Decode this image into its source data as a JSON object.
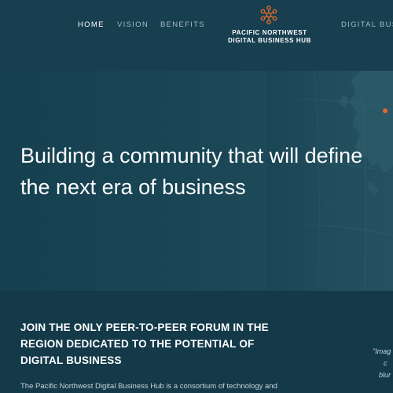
{
  "nav": {
    "links": [
      "HOME",
      "VISION",
      "BENEFITS"
    ],
    "right_link": "DIGITAL BUSI",
    "logo_line1": "PACIFIC NORTHWEST",
    "logo_line2": "DIGITAL BUSINESS HUB",
    "logo_icon": "hub-network-icon",
    "accent": "#e26a2c"
  },
  "hero": {
    "title": "Building a community that will define\nthe next era of business"
  },
  "forum": {
    "heading": "JOIN THE ONLY PEER-TO-PEER FORUM IN THE\nREGION DEDICATED TO THE POTENTIAL OF\nDIGITAL BUSINESS",
    "body": "The Pacific Northwest Digital Business Hub is a consortium of technology and",
    "caption_line1": "\"Imag",
    "caption_line2": "c",
    "caption_line3": "blur"
  }
}
